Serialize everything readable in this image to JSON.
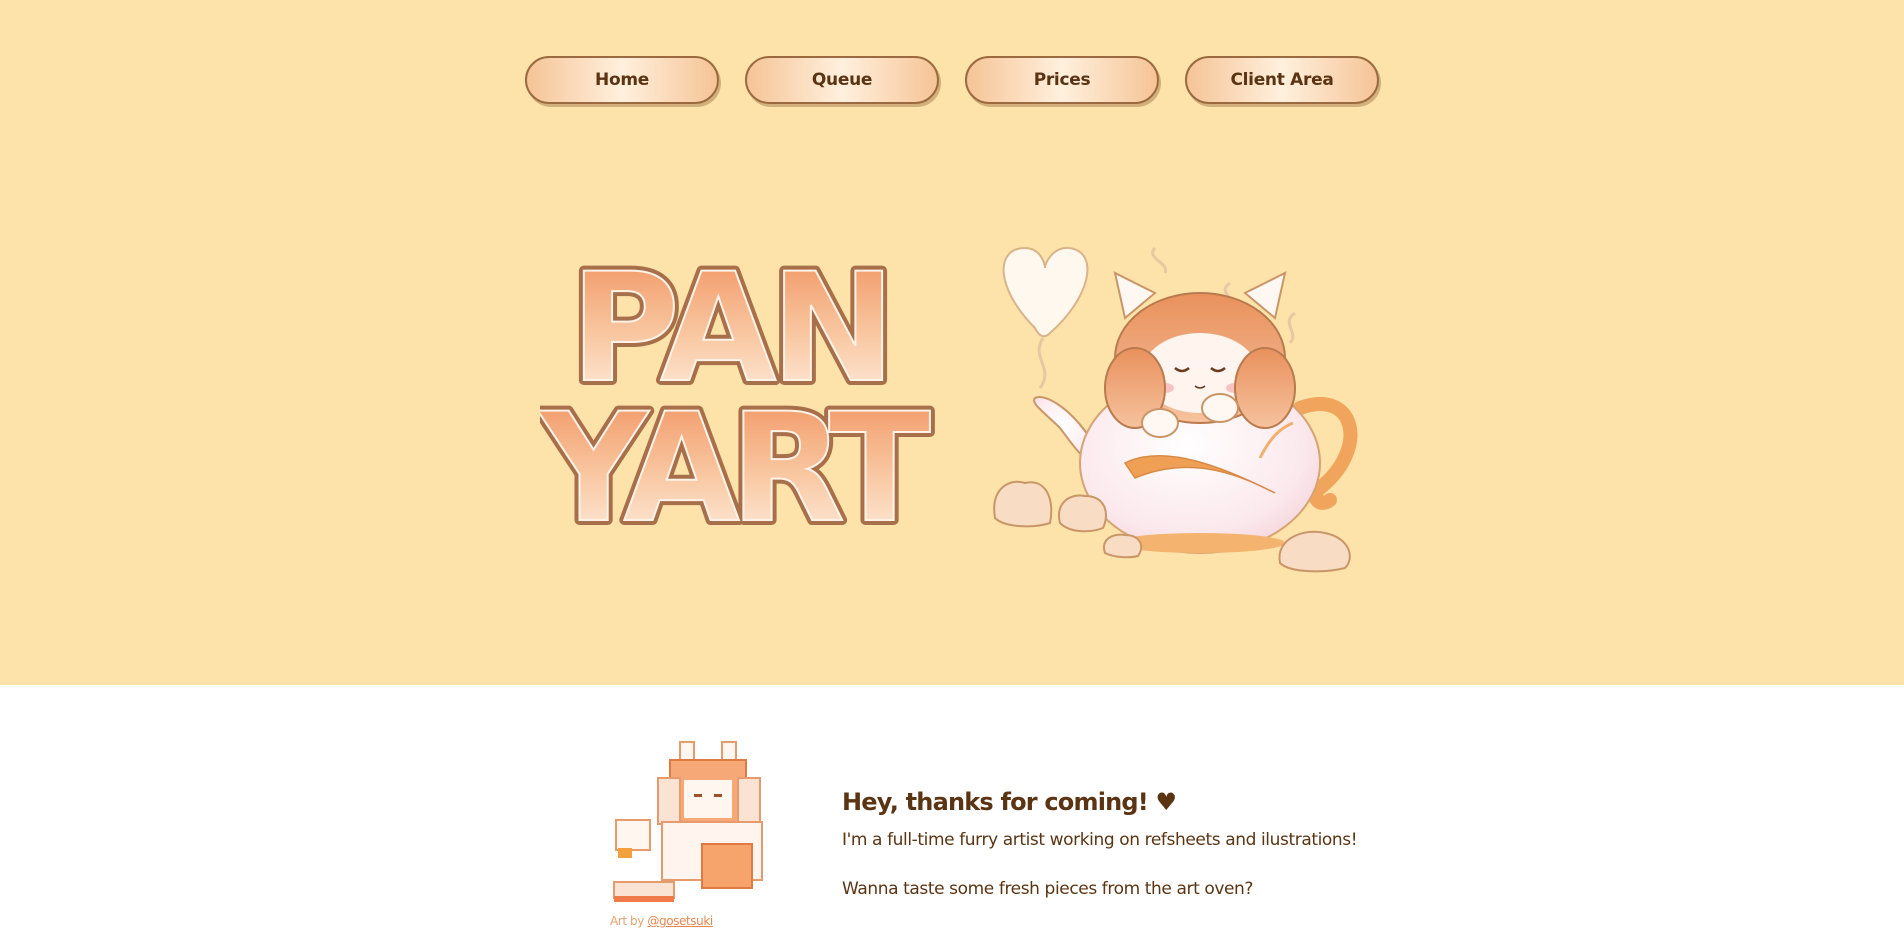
{
  "colors": {
    "hero_background": "#fde3aa",
    "page_background": "#ffffff",
    "text": "#5a3413",
    "accent": "#e8864d",
    "nav_border": "#9b6a41"
  },
  "nav": {
    "items": [
      {
        "label": "Home"
      },
      {
        "label": "Queue"
      },
      {
        "label": "Prices"
      },
      {
        "label": "Client Area"
      }
    ]
  },
  "hero": {
    "logo": {
      "line1": "PAN",
      "line2": "YART"
    },
    "mascot": {
      "icon": "cat-in-teapot-illustration"
    }
  },
  "intro": {
    "title": "Hey, thanks for coming! ♥",
    "line1": "I'm a full-time furry artist working on refsheets and ilustrations!",
    "line2": "Wanna taste some fresh pieces from the art oven?",
    "credit_prefix": "Art by",
    "credit_handle": "@gosetsuki"
  }
}
